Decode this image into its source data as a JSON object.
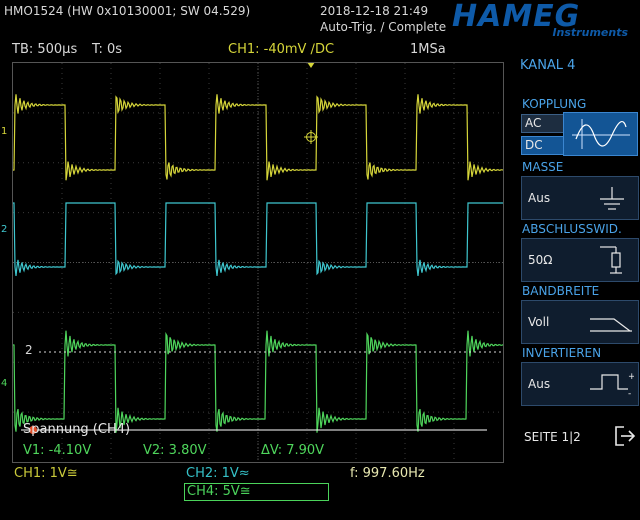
{
  "header": {
    "device": "HMO1524 (HW 0x10130001; SW 04.529)",
    "datetime": "2018-12-18 21:49",
    "trigger_status": "Auto-Trig. / Complete",
    "logo_text": "HAMEG",
    "logo_sub": "Instruments"
  },
  "settings_bar": {
    "timebase": "TB: 500µs",
    "time_offset": "T: 0s",
    "trigger": "CH1: -40mV ∕DC",
    "sample_rate": "1MSa"
  },
  "scope": {
    "channel_markers": [
      "1",
      "2",
      "4"
    ],
    "cursor_label": "Spannung (CH4)",
    "v1": "V1: -4.10V",
    "v2": "V2: 3.80V",
    "dv": "ΔV: 7.90V",
    "ref_marker": "2"
  },
  "side_menu": {
    "title": "KANAL 4",
    "kopplung": {
      "label": "KOPPLUNG",
      "ac": "AC",
      "dc": "DC",
      "selected": "DC"
    },
    "masse": {
      "label": "MASSE",
      "value": "Aus"
    },
    "abschluss": {
      "label": "ABSCHLUSSWID.",
      "value": "50Ω"
    },
    "bandbreite": {
      "label": "BANDBREITE",
      "value": "Voll"
    },
    "invertieren": {
      "label": "INVERTIEREN",
      "value": "Aus"
    },
    "page": "SEITE 1|2"
  },
  "status_bar": {
    "ch1": "CH1: 1V≅",
    "ch2": "CH2: 1V≈",
    "ch4": "CH4: 5V≅",
    "frequency": "f: 997.60Hz"
  },
  "colors": {
    "ch1": "#d6d63a",
    "ch2": "#3fc7cf",
    "ch4": "#4fd65c",
    "accent": "#4aa3e8",
    "logo": "#0e5aa8"
  }
}
